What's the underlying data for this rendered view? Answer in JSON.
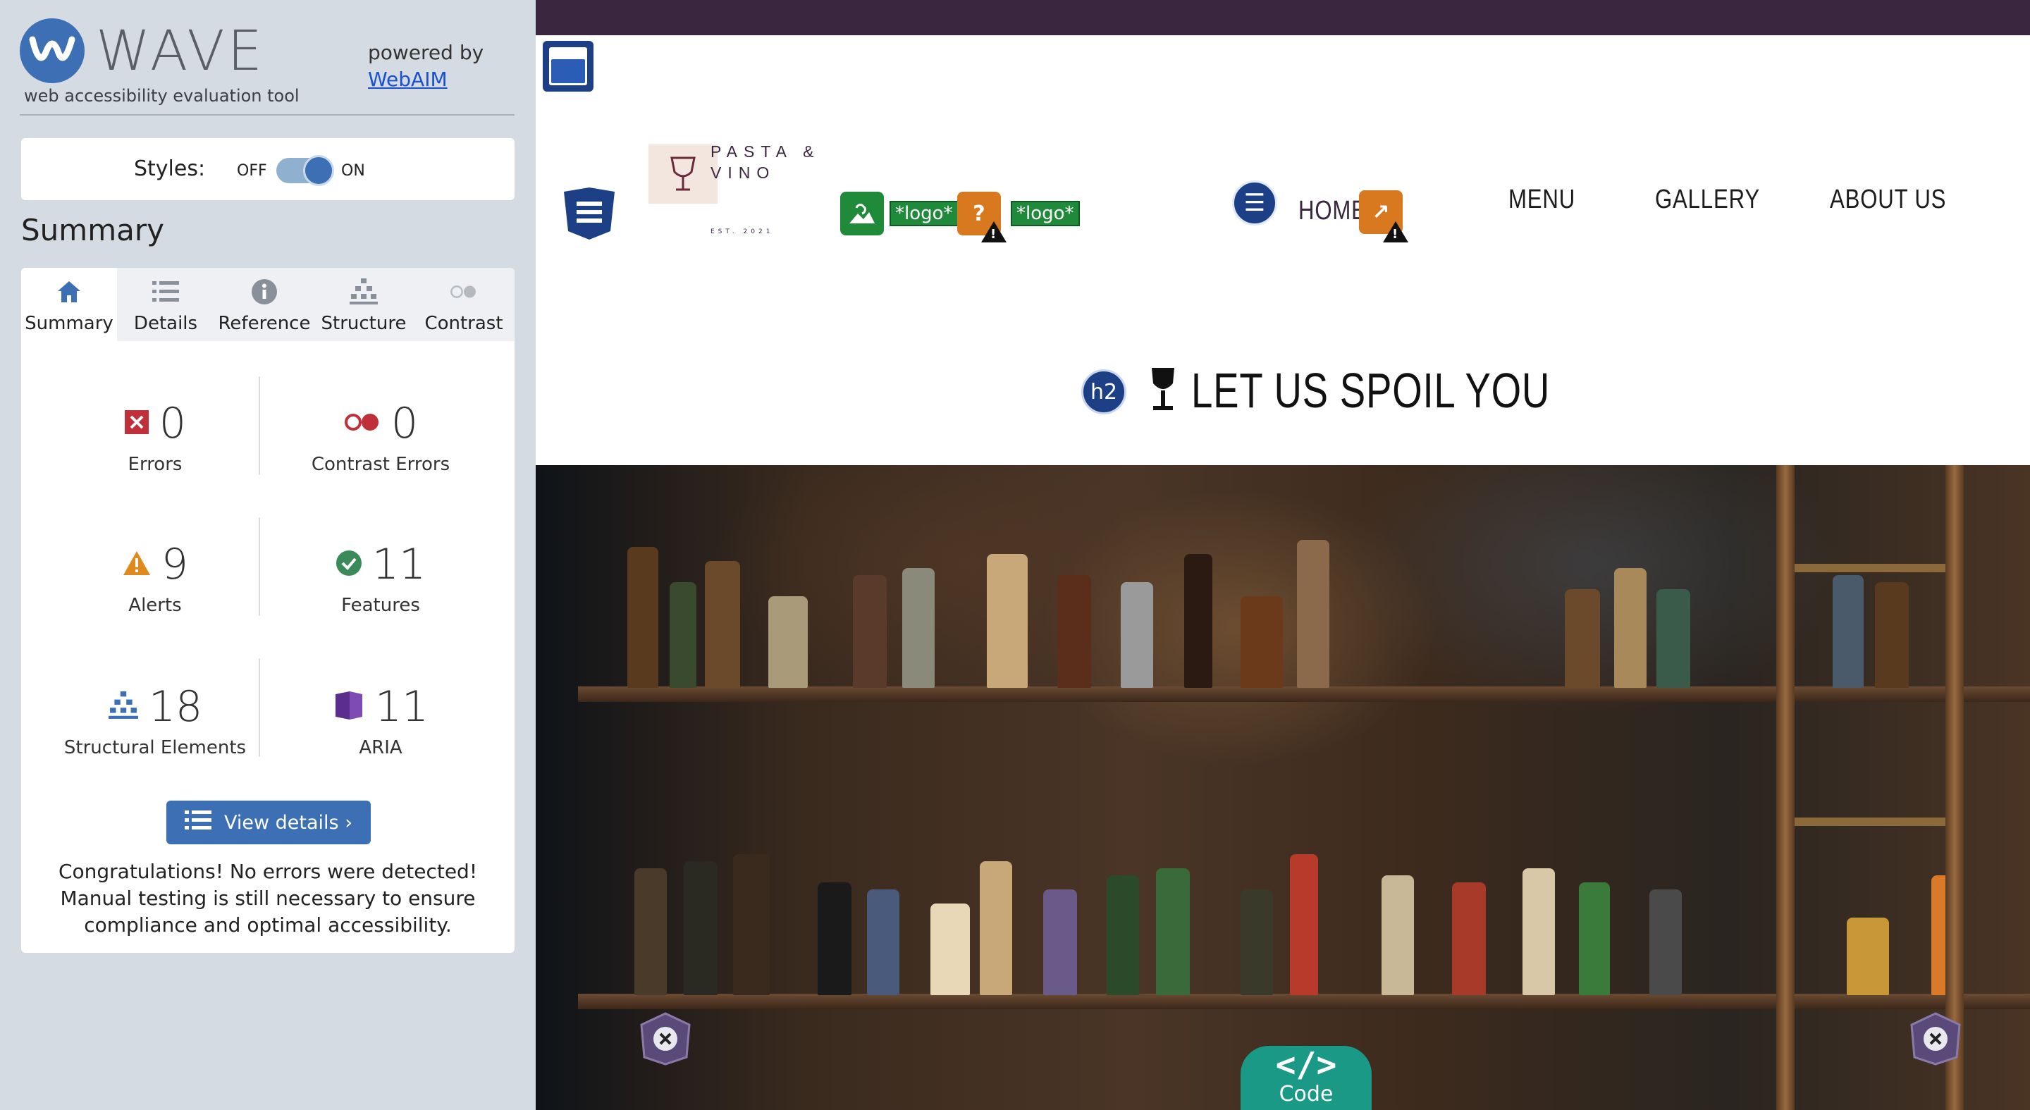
{
  "wave": {
    "brand": "WAVE",
    "tagline": "web accessibility evaluation tool",
    "powered_by": "powered by",
    "webaim_link": "WebAIM",
    "styles_label": "Styles:",
    "styles_off": "OFF",
    "styles_on": "ON",
    "styles_enabled": true,
    "summary_heading": "Summary",
    "tabs": [
      {
        "label": "Summary",
        "icon": "home-icon",
        "active": true
      },
      {
        "label": "Details",
        "icon": "list-icon",
        "active": false
      },
      {
        "label": "Reference",
        "icon": "info-icon",
        "active": false
      },
      {
        "label": "Structure",
        "icon": "structure-icon",
        "active": false
      },
      {
        "label": "Contrast",
        "icon": "contrast-icon",
        "active": false
      }
    ],
    "stats": {
      "errors": {
        "value": "0",
        "label": "Errors"
      },
      "contrast_errors": {
        "value": "0",
        "label": "Contrast Errors"
      },
      "alerts": {
        "value": "9",
        "label": "Alerts"
      },
      "features": {
        "value": "11",
        "label": "Features"
      },
      "structural": {
        "value": "18",
        "label": "Structural Elements"
      },
      "aria": {
        "value": "11",
        "label": "ARIA"
      }
    },
    "details_button": "View details ›",
    "congrats": "Congratulations! No errors were detected! Manual testing is still necessary to ensure compliance and optimal accessibility."
  },
  "site": {
    "brand_name_line1": "PASTA &",
    "brand_name_line2": "VINO",
    "brand_est": "EST. 2021",
    "logo_tag_1": "*logo*",
    "logo_tag_2": "*logo*",
    "nav": {
      "home": "HOME",
      "menu": "MENU",
      "gallery": "GALLERY",
      "about": "ABOUT US"
    },
    "h2_badge": "h2",
    "headline": "LET US SPOIL YOU",
    "code_button": "Code",
    "code_glyph": "</>"
  },
  "colors": {
    "wave_blue": "#3c6fb4",
    "panel_bg": "#d5dbe2",
    "topbar": "#3b2640",
    "feature_green": "#1f8b3a",
    "alert_orange": "#d8791f",
    "error_red": "#c0303a",
    "aria_purple": "#5b2d8c",
    "code_teal": "#1a9a86"
  }
}
